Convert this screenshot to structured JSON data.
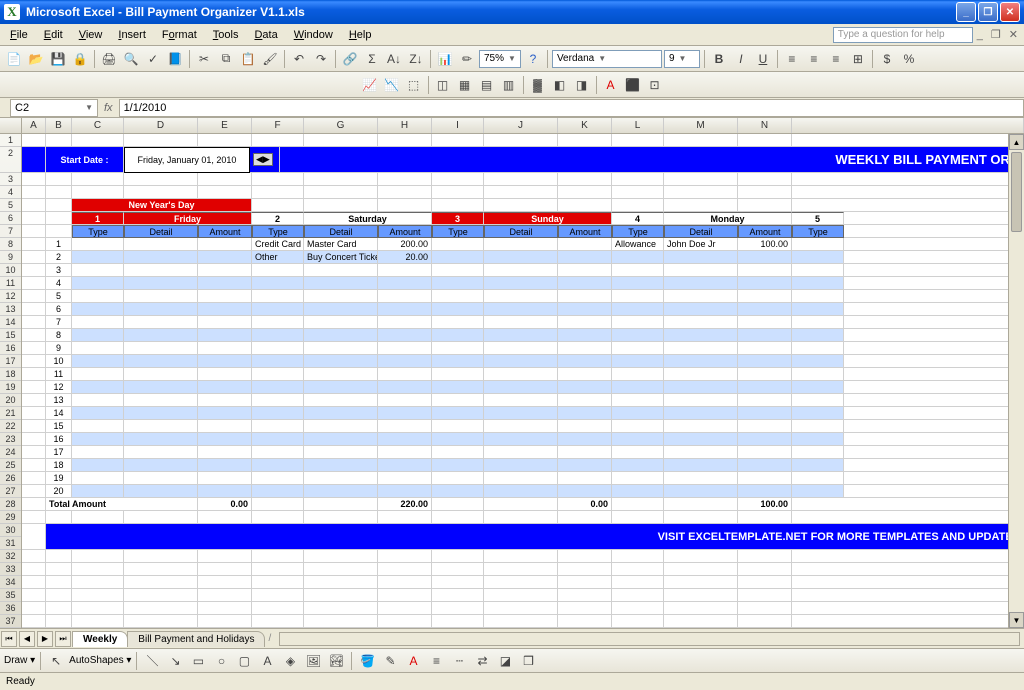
{
  "app": {
    "title": "Microsoft Excel - Bill Payment Organizer V1.1.xls"
  },
  "menu": {
    "file": "File",
    "edit": "Edit",
    "view": "View",
    "insert": "Insert",
    "format": "Format",
    "tools": "Tools",
    "data": "Data",
    "window": "Window",
    "help": "Help",
    "qhelp_placeholder": "Type a question for help"
  },
  "toolbar": {
    "zoom": "75%",
    "font": "Verdana",
    "fontsize": "9"
  },
  "formula_bar": {
    "namebox": "C2",
    "fx": "fx",
    "formula": "1/1/2010"
  },
  "sheet": {
    "start_date_label": "Start Date :",
    "start_date_value": "Friday, January 01, 2010",
    "title_banner": "WEEKLY BILL PAYMENT ORG",
    "holiday": "New Year's Day",
    "days": [
      {
        "num": "1",
        "name": "Friday",
        "red": true,
        "totals": "0.00",
        "rows": []
      },
      {
        "num": "2",
        "name": "Saturday",
        "red": false,
        "totals": "220.00",
        "rows": [
          {
            "type": "Credit Card",
            "detail": "Master Card",
            "amount": "200.00"
          },
          {
            "type": "Other",
            "detail": "Buy Concert Ticket",
            "amount": "20.00"
          }
        ]
      },
      {
        "num": "3",
        "name": "Sunday",
        "red": true,
        "totals": "0.00",
        "rows": []
      },
      {
        "num": "4",
        "name": "Monday",
        "red": false,
        "totals": "100.00",
        "rows": [
          {
            "type": "Allowance",
            "detail": "John Doe Jr",
            "amount": "100.00"
          }
        ]
      },
      {
        "num": "5",
        "name": "",
        "red": false,
        "totals": "",
        "rows": []
      }
    ],
    "col_sub": {
      "type": "Type",
      "detail": "Detail",
      "amount": "Amount"
    },
    "total_label": "Total Amount",
    "footer_msg": "VISIT EXCELTEMPLATE.NET FOR MORE TEMPLATES AND UPDATES"
  },
  "columns": [
    "A",
    "B",
    "C",
    "D",
    "E",
    "F",
    "G",
    "H",
    "I",
    "J",
    "K",
    "L",
    "M",
    "N"
  ],
  "tabs": {
    "active": "Weekly",
    "other": "Bill Payment and Holidays"
  },
  "drawbar": {
    "draw": "Draw",
    "autoshapes": "AutoShapes"
  },
  "status": {
    "ready": "Ready"
  }
}
